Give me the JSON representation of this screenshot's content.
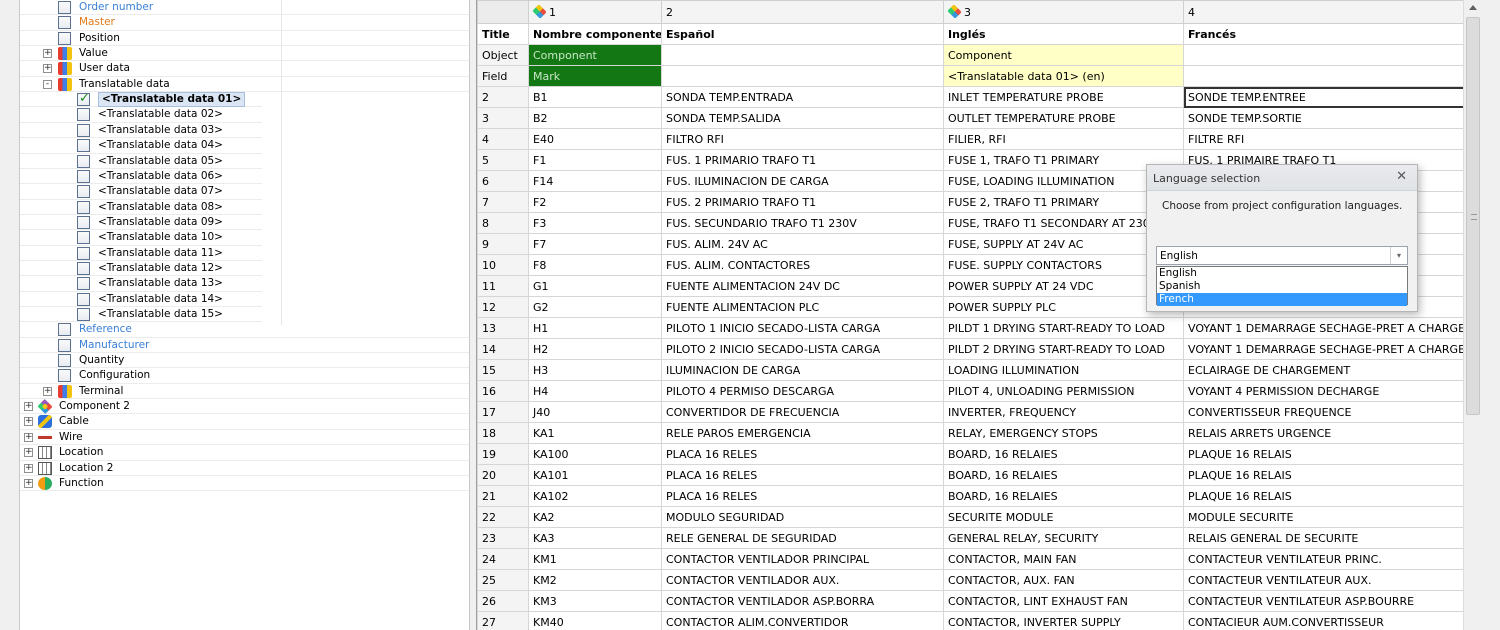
{
  "tree": {
    "items": [
      {
        "label": "Order number",
        "color": "blue",
        "depth": 1,
        "checkbox": true
      },
      {
        "label": "Master",
        "color": "orange",
        "depth": 1,
        "checkbox": true
      },
      {
        "label": "Position",
        "color": "black",
        "depth": 1,
        "checkbox": true
      },
      {
        "label": "Value",
        "color": "black",
        "depth": 1,
        "expander": "+",
        "icon": "database-icon"
      },
      {
        "label": "User data",
        "color": "black",
        "depth": 1,
        "expander": "+",
        "icon": "database-icon"
      },
      {
        "label": "Translatable data",
        "color": "black",
        "depth": 1,
        "expander": "-",
        "icon": "database-icon"
      },
      {
        "label": "<Translatable data 01>",
        "color": "black",
        "depth": 2,
        "checkbox": true,
        "checked": true,
        "selected": true
      },
      {
        "label": "<Translatable data 02>",
        "color": "black",
        "depth": 2,
        "checkbox": true
      },
      {
        "label": "<Translatable data 03>",
        "color": "black",
        "depth": 2,
        "checkbox": true
      },
      {
        "label": "<Translatable data 04>",
        "color": "black",
        "depth": 2,
        "checkbox": true
      },
      {
        "label": "<Translatable data 05>",
        "color": "black",
        "depth": 2,
        "checkbox": true
      },
      {
        "label": "<Translatable data 06>",
        "color": "black",
        "depth": 2,
        "checkbox": true
      },
      {
        "label": "<Translatable data 07>",
        "color": "black",
        "depth": 2,
        "checkbox": true
      },
      {
        "label": "<Translatable data 08>",
        "color": "black",
        "depth": 2,
        "checkbox": true
      },
      {
        "label": "<Translatable data 09>",
        "color": "black",
        "depth": 2,
        "checkbox": true
      },
      {
        "label": "<Translatable data 10>",
        "color": "black",
        "depth": 2,
        "checkbox": true
      },
      {
        "label": "<Translatable data 11>",
        "color": "black",
        "depth": 2,
        "checkbox": true
      },
      {
        "label": "<Translatable data 12>",
        "color": "black",
        "depth": 2,
        "checkbox": true
      },
      {
        "label": "<Translatable data 13>",
        "color": "black",
        "depth": 2,
        "checkbox": true
      },
      {
        "label": "<Translatable data 14>",
        "color": "black",
        "depth": 2,
        "checkbox": true
      },
      {
        "label": "<Translatable data 15>",
        "color": "black",
        "depth": 2,
        "checkbox": true
      },
      {
        "label": "Reference",
        "color": "blue",
        "depth": 1,
        "checkbox": true
      },
      {
        "label": "Manufacturer",
        "color": "blue",
        "depth": 1,
        "checkbox": true
      },
      {
        "label": "Quantity",
        "color": "black",
        "depth": 1,
        "checkbox": true
      },
      {
        "label": "Configuration",
        "color": "black",
        "depth": 1,
        "checkbox": true
      },
      {
        "label": "Terminal",
        "color": "black",
        "depth": 1,
        "expander": "+",
        "icon": "database-icon"
      },
      {
        "label": "Component 2",
        "color": "black",
        "depth": 0,
        "expander": "+",
        "icon": "component-icon"
      },
      {
        "label": "Cable",
        "color": "black",
        "depth": 0,
        "expander": "+",
        "icon": "cable-icon"
      },
      {
        "label": "Wire",
        "color": "black",
        "depth": 0,
        "expander": "+",
        "icon": "wire-icon"
      },
      {
        "label": "Location",
        "color": "black",
        "depth": 0,
        "expander": "+",
        "icon": "location-icon"
      },
      {
        "label": "Location 2",
        "color": "black",
        "depth": 0,
        "expander": "+",
        "icon": "location-icon"
      },
      {
        "label": "Function",
        "color": "black",
        "depth": 0,
        "expander": "+",
        "icon": "function-icon"
      }
    ]
  },
  "grid": {
    "column_numbers": [
      "1",
      "2",
      "3",
      "4"
    ],
    "column_icons": [
      true,
      false,
      true,
      false
    ],
    "meta_rows": [
      {
        "header": "Title",
        "cells": [
          "Nombre componente",
          "Español",
          "Inglés",
          "Francés"
        ]
      },
      {
        "header": "Object",
        "cells": [
          "Component",
          "",
          "Component",
          ""
        ]
      },
      {
        "header": "Field",
        "cells": [
          "Mark",
          "",
          "<Translatable data 01> (en)",
          ""
        ]
      }
    ],
    "rows": [
      {
        "n": "2",
        "mark": "B1",
        "es": "SONDA TEMP.ENTRADA",
        "en": "INLET TEMPERATURE PROBE",
        "fr": "SONDE TEMP.ENTREE"
      },
      {
        "n": "3",
        "mark": "B2",
        "es": "SONDA TEMP.SALIDA",
        "en": "OUTLET TEMPERATURE PROBE",
        "fr": "SONDE TEMP.SORTIE"
      },
      {
        "n": "4",
        "mark": "E40",
        "es": "FILTRO RFI",
        "en": "FILIER, RFI",
        "fr": "FILTRE RFI"
      },
      {
        "n": "5",
        "mark": "F1",
        "es": "FUS. 1 PRIMARIO TRAFO T1",
        "en": "FUSE 1, TRAFO T1 PRIMARY",
        "fr": "FUS. 1 PRIMAIRE TRAFO T1"
      },
      {
        "n": "6",
        "mark": "F14",
        "es": "FUS. ILUMINACION DE CARGA",
        "en": "FUSE, LOADING ILLUMINATION",
        "fr": ""
      },
      {
        "n": "7",
        "mark": "F2",
        "es": "FUS. 2 PRIMARIO TRAFO T1",
        "en": "FUSE 2, TRAFO T1 PRIMARY",
        "fr": ""
      },
      {
        "n": "8",
        "mark": "F3",
        "es": "FUS. SECUNDARIO TRAFO T1 230V",
        "en": "FUSE, TRAFO T1 SECONDARY AT 230V AC",
        "fr": ""
      },
      {
        "n": "9",
        "mark": "F7",
        "es": "FUS. ALIM. 24V AC",
        "en": "FUSE, SUPPLY AT 24V AC",
        "fr": ""
      },
      {
        "n": "10",
        "mark": "F8",
        "es": "FUS. ALIM. CONTACTORES",
        "en": "FUSE. SUPPLY CONTACTORS",
        "fr": ""
      },
      {
        "n": "11",
        "mark": "G1",
        "es": "FUENTE ALIMENTACION 24V DC",
        "en": "POWER SUPPLY AT 24 VDC",
        "fr": ""
      },
      {
        "n": "12",
        "mark": "G2",
        "es": "FUENTE ALIMENTACION PLC",
        "en": "POWER SUPPLY PLC",
        "fr": ""
      },
      {
        "n": "13",
        "mark": "H1",
        "es": "PILOTO 1 INICIO SECADO-LISTA CARGA",
        "en": "PILDT 1 DRYING START-READY TO LOAD",
        "fr": "VOYANT 1 DEMARRAGE SECHAGE-PRET A CHARGE"
      },
      {
        "n": "14",
        "mark": "H2",
        "es": "PILOTO 2 INICIO SECADO-LISTA CARGA",
        "en": "PILDT 2 DRYING START-READY TO LOAD",
        "fr": "VOYANT 1 DEMARRAGE SECHAGE-PRET A CHARGE"
      },
      {
        "n": "15",
        "mark": "H3",
        "es": "ILUMINACION DE CARGA",
        "en": "LOADING ILLUMINATION",
        "fr": "ECLAIRAGE DE CHARGEMENT"
      },
      {
        "n": "16",
        "mark": "H4",
        "es": "PILOTO 4 PERMISO DESCARGA",
        "en": "PILOT 4, UNLOADING PERMISSION",
        "fr": "VOYANT 4 PERMISSION DECHARGE"
      },
      {
        "n": "17",
        "mark": "J40",
        "es": "CONVERTIDOR DE FRECUENCIA",
        "en": "INVERTER, FREQUENCY",
        "fr": "CONVERTISSEUR FREQUENCE"
      },
      {
        "n": "18",
        "mark": "KA1",
        "es": "RELE PAROS EMERGENCIA",
        "en": "RELAY, EMERGENCY STOPS",
        "fr": "RELAIS ARRETS URGENCE"
      },
      {
        "n": "19",
        "mark": "KA100",
        "es": "PLACA 16 RELES",
        "en": "BOARD, 16 RELAIES",
        "fr": "PLAQUE 16 RELAIS"
      },
      {
        "n": "20",
        "mark": "KA101",
        "es": "PLACA 16 RELES",
        "en": "BOARD, 16 RELAIES",
        "fr": "PLAQUE 16 RELAIS"
      },
      {
        "n": "21",
        "mark": "KA102",
        "es": "PLACA 16 RELES",
        "en": "BOARD, 16 RELAIES",
        "fr": "PLAQUE 16 RELAIS"
      },
      {
        "n": "22",
        "mark": "KA2",
        "es": "MODULO SEGURIDAD",
        "en": "SECURITE MODULE",
        "fr": "MODULE SECURITE"
      },
      {
        "n": "23",
        "mark": "KA3",
        "es": "RELE GENERAL DE SEGURIDAD",
        "en": "GENERAL RELAY, SECURITY",
        "fr": "RELAIS GENERAL DE SECURITE"
      },
      {
        "n": "24",
        "mark": "KM1",
        "es": "CONTACTOR VENTILADOR PRINCIPAL",
        "en": "CONTACTOR, MAIN FAN",
        "fr": "CONTACTEUR VENTILATEUR PRINC."
      },
      {
        "n": "25",
        "mark": "KM2",
        "es": "CONTACTOR VENTILADOR AUX.",
        "en": "CONTACTOR, AUX. FAN",
        "fr": "CONTACTEUR VENTILATEUR AUX."
      },
      {
        "n": "26",
        "mark": "KM3",
        "es": "CONTACTOR VENTILADOR ASP.BORRA",
        "en": "CONTACTOR, LINT EXHAUST FAN",
        "fr": "CONTACTEUR VENTILATEUR ASP.BOURRE"
      },
      {
        "n": "27",
        "mark": "KM40",
        "es": "CONTACTOR ALIM.CONVERTIDOR",
        "en": "CONTACTOR, INVERTER SUPPLY",
        "fr": "CONTACIEUR AUM.CONVERTISSEUR"
      }
    ]
  },
  "dialog": {
    "title": "Language selection",
    "close_glyph": "✕",
    "message": "Choose from project configuration languages.",
    "combo_value": "English",
    "combo_arrow": "▾",
    "options": [
      "English",
      "Spanish",
      "French"
    ],
    "selected_index": 2
  }
}
